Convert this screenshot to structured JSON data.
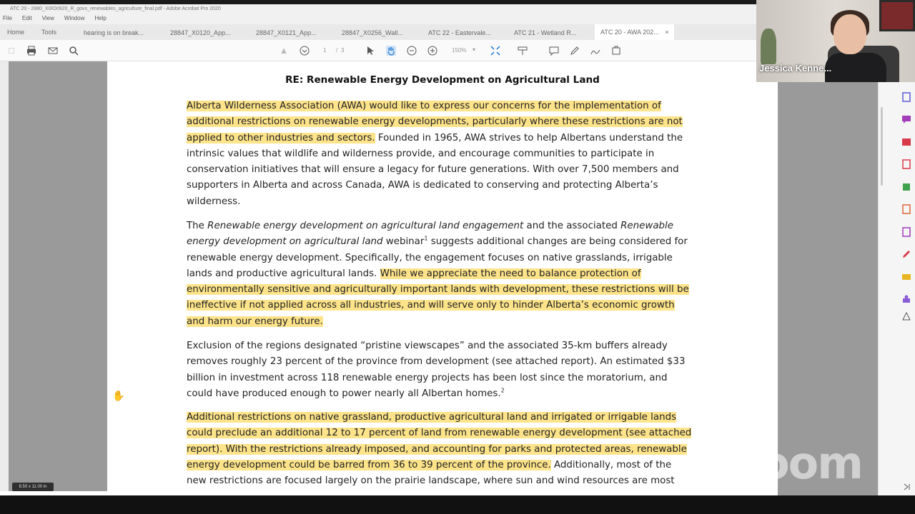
{
  "window": {
    "title": "ATC 20 - 2880_X0IO0920_R_govs_renewables_agriculture_final.pdf - Adobe Acrobat Pro 2020",
    "menu": [
      "File",
      "Edit",
      "View",
      "Window",
      "Help"
    ]
  },
  "tabs": {
    "home": "Home",
    "tools": "Tools",
    "t1": "hearing is on break...",
    "t2": "28847_X0120_App...",
    "t3": "28847_X0121_App...",
    "t4": "28847_X0256_Wall...",
    "t5": "ATC 22 - Eastervale...",
    "t6": "ATC 21 - Wetland R...",
    "t7": "ATC 20 - AWA 202...",
    "close": "×"
  },
  "toolbar": {
    "page_current": "1",
    "page_sep": "/",
    "page_total": "3",
    "zoom": "150%"
  },
  "document": {
    "title": "RE: Renewable Energy Development on Agricultural Land",
    "p1": [
      {
        "hl": "Alberta Wilderness Association (AWA) would like to express our concerns for the implementation of",
        "plain": ""
      },
      {
        "hl": "additional restrictions on renewable energy developments, particularly where these restrictions are not",
        "plain": ""
      },
      {
        "hl": "applied to other industries and sectors.",
        "plain": " Founded in 1965, AWA strives to help Albertans understand the"
      },
      {
        "hl": "",
        "plain": "intrinsic values that wildlife and wilderness provide, and encourage communities to participate in"
      },
      {
        "hl": "",
        "plain": "conservation initiatives that will ensure a legacy for future generations. With over 7,500 members and"
      },
      {
        "hl": "",
        "plain": "supporters in Alberta and across Canada, AWA is dedicated to conserving and protecting Alberta’s"
      },
      {
        "hl": "",
        "plain": "wilderness."
      }
    ],
    "p2": {
      "l1a": "The ",
      "l1b": "Renewable energy development on agricultural land engagement",
      "l1c": " and the associated ",
      "l1d": "Renewable",
      "l2a": "energy development on agricultural land",
      "l2b": " webinar",
      "l2sup": "1",
      "l2c": " suggests additional changes are being considered for",
      "l3": "renewable energy development. Specifically, the engagement focuses on native grasslands, irrigable",
      "l4a": "lands and productive agricultural lands. ",
      "l4b": "While we appreciate the need to balance protection of",
      "l5": "environmentally sensitive and agriculturally important lands with development, these restrictions will be",
      "l6": "ineffective if not applied across all industries, and will serve only to hinder Alberta’s economic growth",
      "l7": "and harm our energy future."
    },
    "p3": {
      "l1": "Exclusion of the regions designated “pristine viewscapes” and the associated 35-km buffers already",
      "l2": "removes roughly 23 percent of the province from development (see attached report). An estimated $33",
      "l3": "billion in investment across 118 renewable energy projects has been lost since the moratorium, and",
      "l4": "could have produced enough to power nearly all Albertan homes.",
      "l4sup": "2"
    },
    "p4": {
      "l1": "Additional restrictions on native grassland, productive agricultural land and irrigated or irrigable lands",
      "l2": "could preclude an additional 12 to 17 percent of land from renewable energy development (see attached",
      "l3": "report). With the restrictions already imposed, and accounting for parks and protected areas, renewable",
      "l4a": "energy development could be barred from 36 to 39 percent of the province.",
      "l4b": " Additionally, most of the",
      "l5": "new restrictions are focused largely on the prairie landscape, where sun and wind resources are most"
    }
  },
  "page_size_label": "8.50 x 11.00 in",
  "video": {
    "participant_name": "Jessica Kenne..."
  },
  "watermark": "zoom",
  "colors": {
    "highlight": "#fde38a",
    "gray_bg": "#9a9a9a"
  }
}
